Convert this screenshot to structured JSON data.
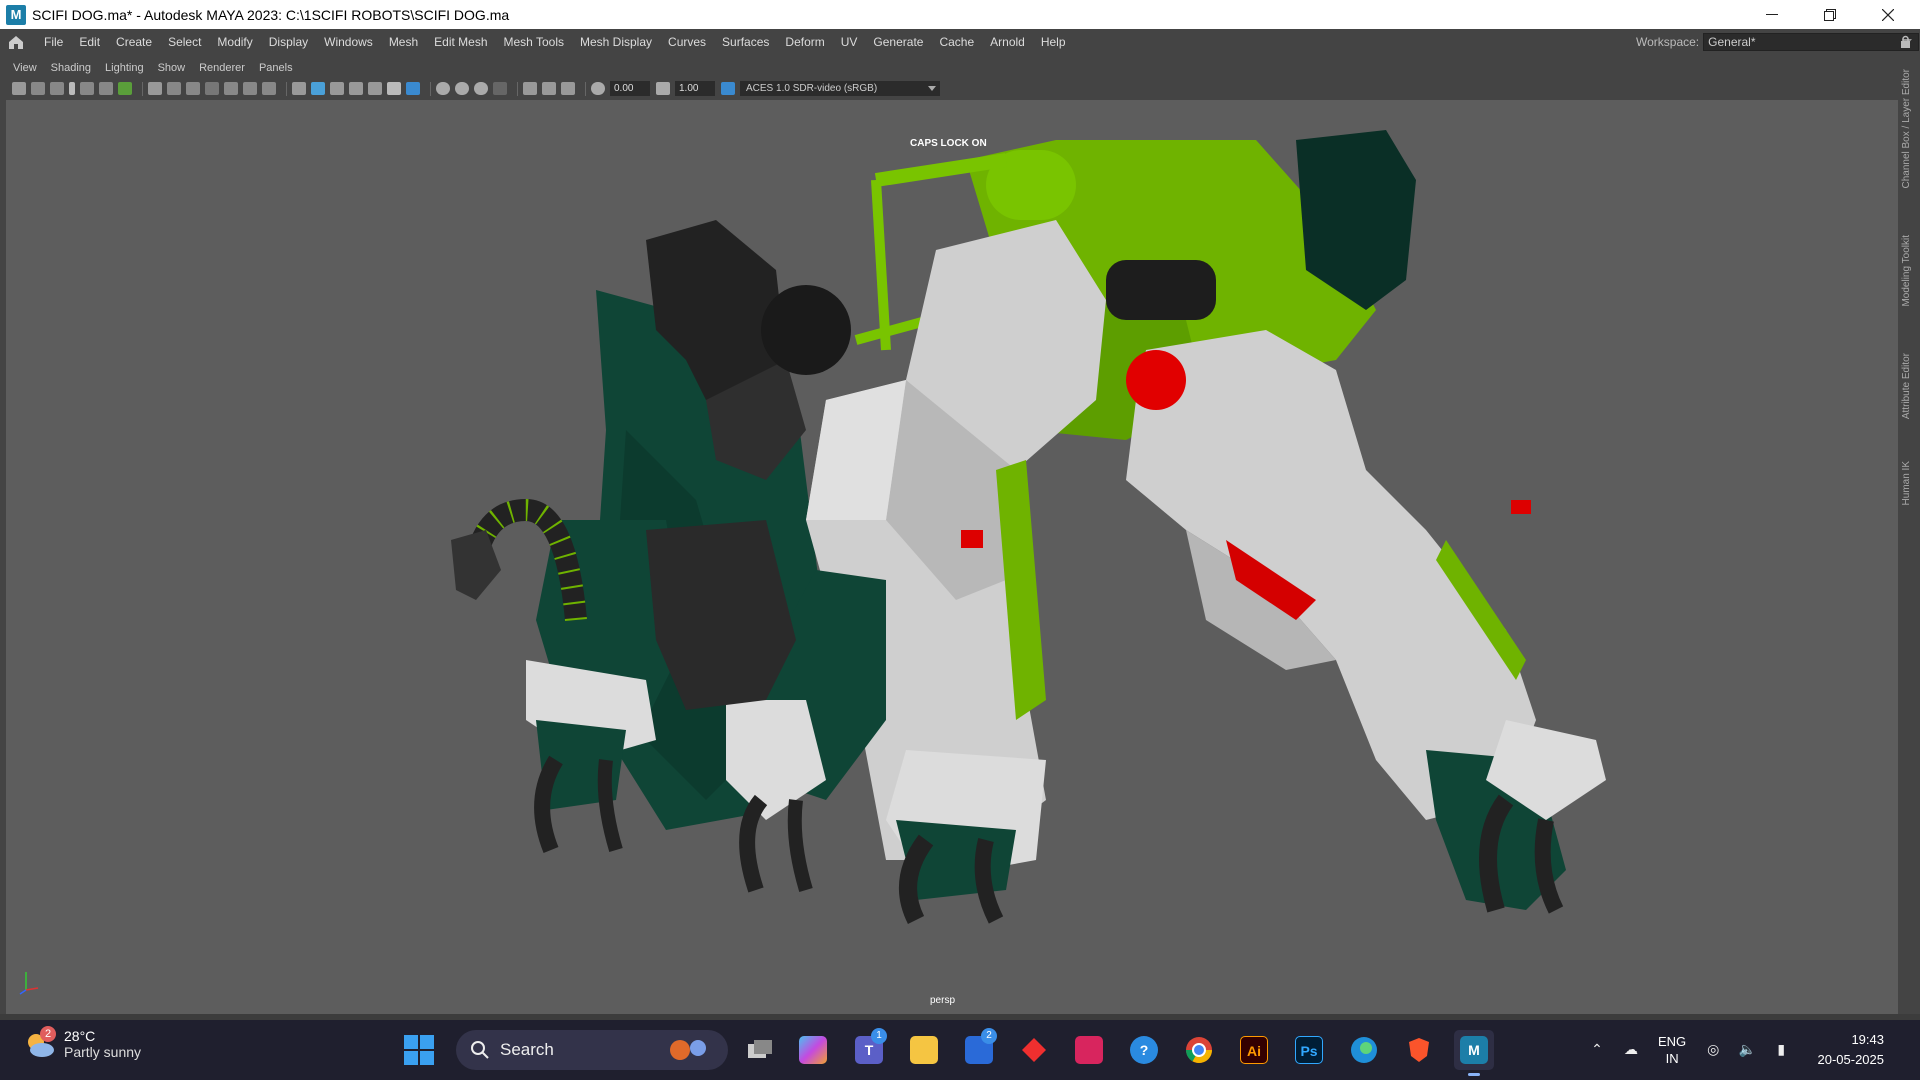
{
  "window": {
    "title": "SCIFI DOG.ma* - Autodesk MAYA 2023: C:\\1SCIFI ROBOTS\\SCIFI DOG.ma",
    "app_icon": "M"
  },
  "menubar": {
    "items": [
      "File",
      "Edit",
      "Create",
      "Select",
      "Modify",
      "Display",
      "Windows",
      "Mesh",
      "Edit Mesh",
      "Mesh Tools",
      "Mesh Display",
      "Curves",
      "Surfaces",
      "Deform",
      "UV",
      "Generate",
      "Cache",
      "Arnold",
      "Help"
    ],
    "workspace_label": "Workspace:",
    "workspace_value": "General*"
  },
  "panel_menu": {
    "items": [
      "View",
      "Shading",
      "Lighting",
      "Show",
      "Renderer",
      "Panels"
    ]
  },
  "panel_toolbar": {
    "field_1": "0.00",
    "field_2": "1.00",
    "color_management": "ACES 1.0 SDR-video (sRGB)"
  },
  "viewport": {
    "caps_lock": "CAPS LOCK ON",
    "camera_label": "persp"
  },
  "right_dock": {
    "tabs": [
      "Channel Box / Layer Editor",
      "Modeling Toolkit",
      "Attribute Editor",
      "Human IK"
    ]
  },
  "taskbar": {
    "weather_badge": "2",
    "temperature": "28°C",
    "condition": "Partly sunny",
    "search_label": "Search",
    "teams_badge": "1",
    "store_badge": "2",
    "language_line1": "ENG",
    "language_line2": "IN",
    "time": "19:43",
    "date": "20-05-2025"
  },
  "colors": {
    "accent_green": "#6fb300",
    "dark_teal": "#0f4536",
    "robot_white": "#d0d0d0",
    "robot_black": "#2a2a2a",
    "viewport_bg": "#5d5d5d"
  }
}
